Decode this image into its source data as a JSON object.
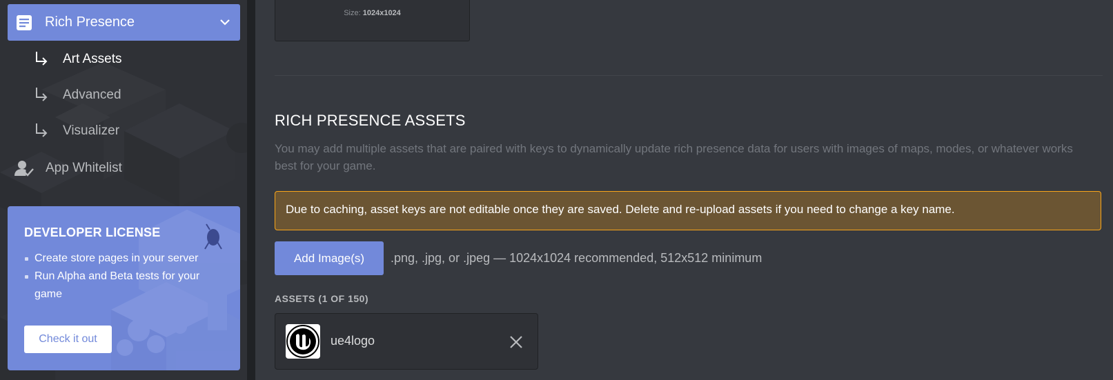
{
  "sidebar": {
    "parent": {
      "label": "Rich Presence",
      "icon": "document-icon",
      "chevron": "chevron-down-icon"
    },
    "subitems": [
      {
        "label": "Art Assets",
        "active": true,
        "icon": "subdirectory-arrow-icon"
      },
      {
        "label": "Advanced",
        "active": false,
        "icon": "subdirectory-arrow-icon"
      },
      {
        "label": "Visualizer",
        "active": false,
        "icon": "subdirectory-arrow-icon"
      }
    ],
    "whitelist": {
      "label": "App Whitelist",
      "icon": "user-whitelist-icon"
    },
    "promo": {
      "title": "DEVELOPER LICENSE",
      "bullets": [
        "Create store pages in your server",
        "Run Alpha and Beta tests for your game"
      ],
      "cta": "Check it out"
    }
  },
  "main": {
    "upload": {
      "size_label": "Size:",
      "size_value": "1024x1024"
    },
    "section_title": "RICH PRESENCE ASSETS",
    "section_desc": "You may add multiple assets that are paired with keys to dynamically update rich presence data for users with images of maps, modes, or whatever works best for your game.",
    "warning": "Due to caching, asset keys are not editable once they are saved. Delete and re-upload assets if you need to change a key name.",
    "add_button": "Add Image(s)",
    "formats": ".png, .jpg, or .jpeg — 1024x1024 recommended, 512x512 minimum",
    "assets_label": "ASSETS (1 OF 150)",
    "assets": [
      {
        "name": "ue4logo",
        "thumb_icon": "unreal-engine-logo-icon",
        "remove_icon": "close-icon"
      }
    ]
  },
  "colors": {
    "accent": "#7289da",
    "background": "#36393f",
    "sidebar": "#2f3136",
    "warning_bg": "#6b5533",
    "warning_border": "#faa61a"
  }
}
